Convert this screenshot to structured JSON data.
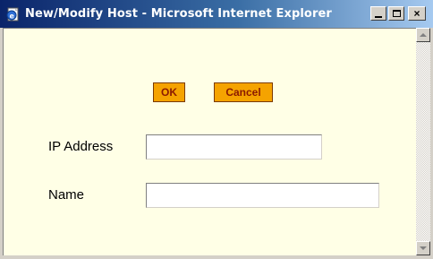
{
  "window": {
    "title": "New/Modify Host - Microsoft Internet Explorer",
    "icon": "ie-page-icon",
    "controls": {
      "minimize": "minimize-icon",
      "maximize": "maximize-icon",
      "close_label": "×"
    }
  },
  "form": {
    "ok_label": "OK",
    "cancel_label": "Cancel",
    "ip_label": "IP Address",
    "ip_value": "",
    "name_label": "Name",
    "name_value": ""
  },
  "colors": {
    "page_background": "#ffffe6",
    "button_fill": "#f5a300",
    "button_text": "#8b1a00",
    "title_gradient_start": "#0a246a",
    "title_gradient_end": "#a6caf0"
  }
}
